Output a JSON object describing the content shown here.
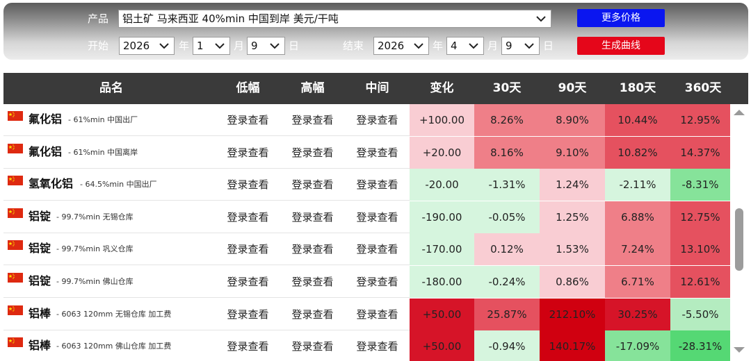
{
  "filters": {
    "product_label": "产品",
    "product_value": "铝土矿 马来西亚 40%min 中国到岸 美元/干吨",
    "start_label": "开始",
    "end_label": "结束",
    "start": {
      "year": "2026",
      "month": "1",
      "day": "9"
    },
    "end": {
      "year": "2026",
      "month": "4",
      "day": "9"
    },
    "year_unit": "年",
    "month_unit": "月",
    "day_unit": "日",
    "more_prices_button": "更多价格",
    "generate_curve_button": "生成曲线"
  },
  "table": {
    "headers": [
      "品名",
      "低幅",
      "高幅",
      "中间",
      "变化",
      "30天",
      "90天",
      "180天",
      "360天"
    ],
    "rows": [
      {
        "name": "氟化铝",
        "spec": "- 61%min 中国出厂",
        "low": "登录查看",
        "high": "登录查看",
        "mid": "登录查看",
        "change": "+100.00",
        "d30": "8.26%",
        "d90": "8.90%",
        "d180": "10.44%",
        "d360": "12.95%"
      },
      {
        "name": "氟化铝",
        "spec": "- 61%min 中国离岸",
        "low": "登录查看",
        "high": "登录查看",
        "mid": "登录查看",
        "change": "+20.00",
        "d30": "8.16%",
        "d90": "9.10%",
        "d180": "10.82%",
        "d360": "14.37%"
      },
      {
        "name": "氢氧化铝",
        "spec": "- 64.5%min 中国出厂",
        "low": "登录查看",
        "high": "登录查看",
        "mid": "登录查看",
        "change": "-20.00",
        "d30": "-1.31%",
        "d90": "1.24%",
        "d180": "-2.11%",
        "d360": "-8.31%"
      },
      {
        "name": "铝锭",
        "spec": "- 99.7%min 无锡仓库",
        "low": "登录查看",
        "high": "登录查看",
        "mid": "登录查看",
        "change": "-190.00",
        "d30": "-0.05%",
        "d90": "1.25%",
        "d180": "6.88%",
        "d360": "12.75%"
      },
      {
        "name": "铝锭",
        "spec": "- 99.7%min 巩义仓库",
        "low": "登录查看",
        "high": "登录查看",
        "mid": "登录查看",
        "change": "-170.00",
        "d30": "0.12%",
        "d90": "1.53%",
        "d180": "7.24%",
        "d360": "13.10%"
      },
      {
        "name": "铝锭",
        "spec": "- 99.7%min 佛山仓库",
        "low": "登录查看",
        "high": "登录查看",
        "mid": "登录查看",
        "change": "-180.00",
        "d30": "-0.24%",
        "d90": "0.86%",
        "d180": "6.71%",
        "d360": "12.61%"
      },
      {
        "name": "铝棒",
        "spec": "- 6063 120mm 无锡仓库 加工费",
        "low": "登录查看",
        "high": "登录查看",
        "mid": "登录查看",
        "change": "+50.00",
        "d30": "25.87%",
        "d90": "212.10%",
        "d180": "30.25%",
        "d360": "-5.50%"
      },
      {
        "name": "铝棒",
        "spec": "- 6063 120mm 佛山仓库 加工费",
        "low": "登录查看",
        "high": "登录查看",
        "mid": "登录查看",
        "change": "+50.00",
        "d30": "-0.94%",
        "d90": "140.17%",
        "d180": "-17.09%",
        "d360": "-28.31%"
      }
    ]
  },
  "colors": {
    "up_light": "#f9cdd3",
    "up_medium": "#ef7f88",
    "up_strong": "#e5515f",
    "up_deep": "#d61428",
    "up_extreme": "#d00010",
    "down_light": "#d6f5de",
    "down_medium": "#b4ecc0",
    "down_strong": "#86e39a",
    "down_deep": "#55d874"
  },
  "cell_colors": [
    [
      "up_light",
      "up_medium",
      "up_medium",
      "up_strong",
      "up_strong"
    ],
    [
      "up_light",
      "up_medium",
      "up_medium",
      "up_strong",
      "up_strong"
    ],
    [
      "down_light",
      "down_light",
      "up_light",
      "down_light",
      "down_strong"
    ],
    [
      "down_light",
      "down_light",
      "up_light",
      "up_medium",
      "up_strong"
    ],
    [
      "down_light",
      "up_light",
      "up_light",
      "up_medium",
      "up_strong"
    ],
    [
      "down_light",
      "down_light",
      "up_light",
      "up_medium",
      "up_strong"
    ],
    [
      "up_deep",
      "up_strong",
      "up_extreme",
      "up_deep",
      "down_medium"
    ],
    [
      "up_deep",
      "down_light",
      "up_extreme",
      "down_strong",
      "down_deep"
    ]
  ],
  "icons": {
    "flag": "china-flag-icon",
    "dropdown": "chevron-down-icon",
    "scroll_up": "scroll-up-arrow-icon",
    "scroll_down": "scroll-down-arrow-icon"
  }
}
